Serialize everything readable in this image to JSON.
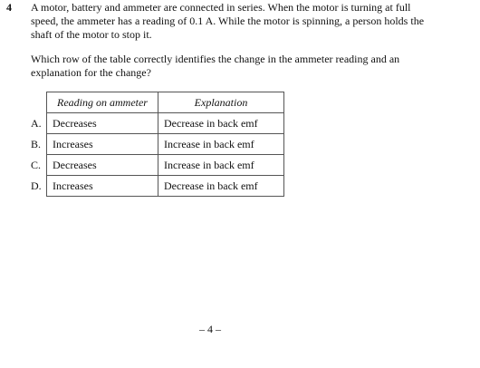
{
  "question": {
    "number": "4",
    "stem": "A motor, battery and ammeter are connected in series. When the motor is turning at full speed, the ammeter has a reading of 0.1 A. While the motor is spinning, a person holds the shaft of the motor to stop it.",
    "prompt": "Which row of the table correctly identifies the change in the ammeter reading and an explanation for the change?"
  },
  "table": {
    "headers": [
      "Reading on ammeter",
      "Explanation"
    ],
    "rows": [
      {
        "letter": "A.",
        "reading": "Decreases",
        "explanation": "Decrease in back emf"
      },
      {
        "letter": "B.",
        "reading": "Increases",
        "explanation": "Increase in back emf"
      },
      {
        "letter": "C.",
        "reading": "Decreases",
        "explanation": "Increase in back emf"
      },
      {
        "letter": "D.",
        "reading": "Increases",
        "explanation": "Decrease in back emf"
      }
    ]
  },
  "footer": {
    "page_number": "– 4 –"
  }
}
